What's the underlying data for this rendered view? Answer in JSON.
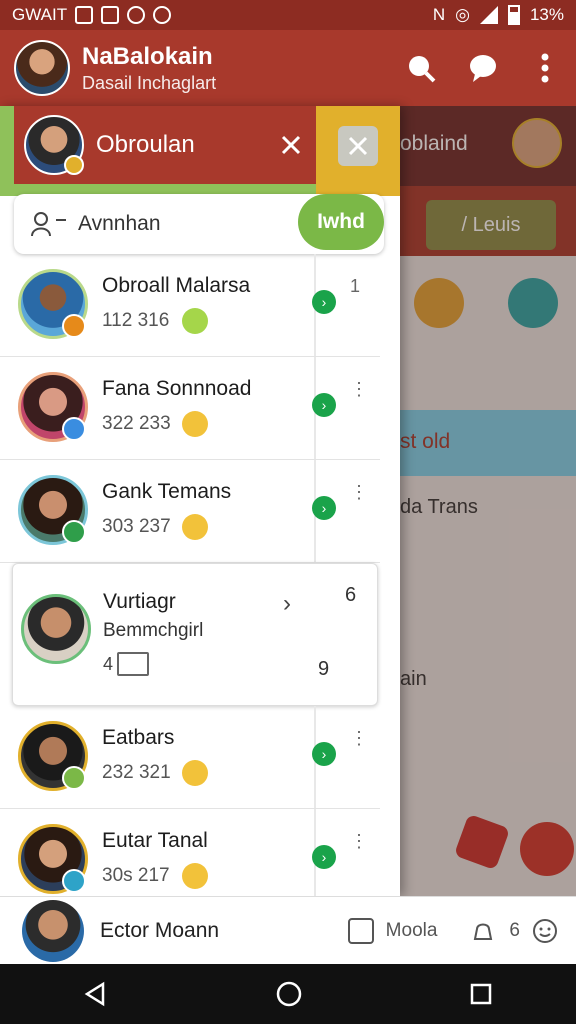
{
  "status_bar": {
    "carrier": "GWAIT",
    "battery": "13%"
  },
  "app_bar": {
    "title": "NaBalokain",
    "subtitle": "Dasail Inchaglart"
  },
  "background_pane": {
    "card1": "oblaind",
    "card2": "/ Leuis",
    "row1": "st old",
    "row2": "da Trans",
    "row3": "ain"
  },
  "drawer": {
    "header_name": "Obroulan",
    "search_label": "Avnnhan",
    "add_button": "Iwhd",
    "contacts": [
      {
        "name": "Obroall Malarsa",
        "number": "112 316",
        "more": "1"
      },
      {
        "name": "Fana Sonnnoad",
        "number": "322 233",
        "more": "⋮"
      },
      {
        "name": "Gank Temans",
        "number": "303 237",
        "more": "⋮"
      },
      {
        "name": "Eatbars",
        "number": "232 321",
        "more": "⋮"
      },
      {
        "name": "Eutar Tanal",
        "number": "30s 217",
        "more": "⋮"
      }
    ],
    "expanded": {
      "name": "Vurtiagr",
      "sub": "Bemmchgirl",
      "small": "4",
      "marker_a": "6",
      "marker_b": "9"
    }
  },
  "bottom_bar": {
    "name": "Ector Moann",
    "tool_label": "Moola",
    "count": "6"
  },
  "colors": {
    "primary": "#a8392c",
    "accent_green": "#7bb847",
    "accent_yellow": "#e1b02c"
  }
}
